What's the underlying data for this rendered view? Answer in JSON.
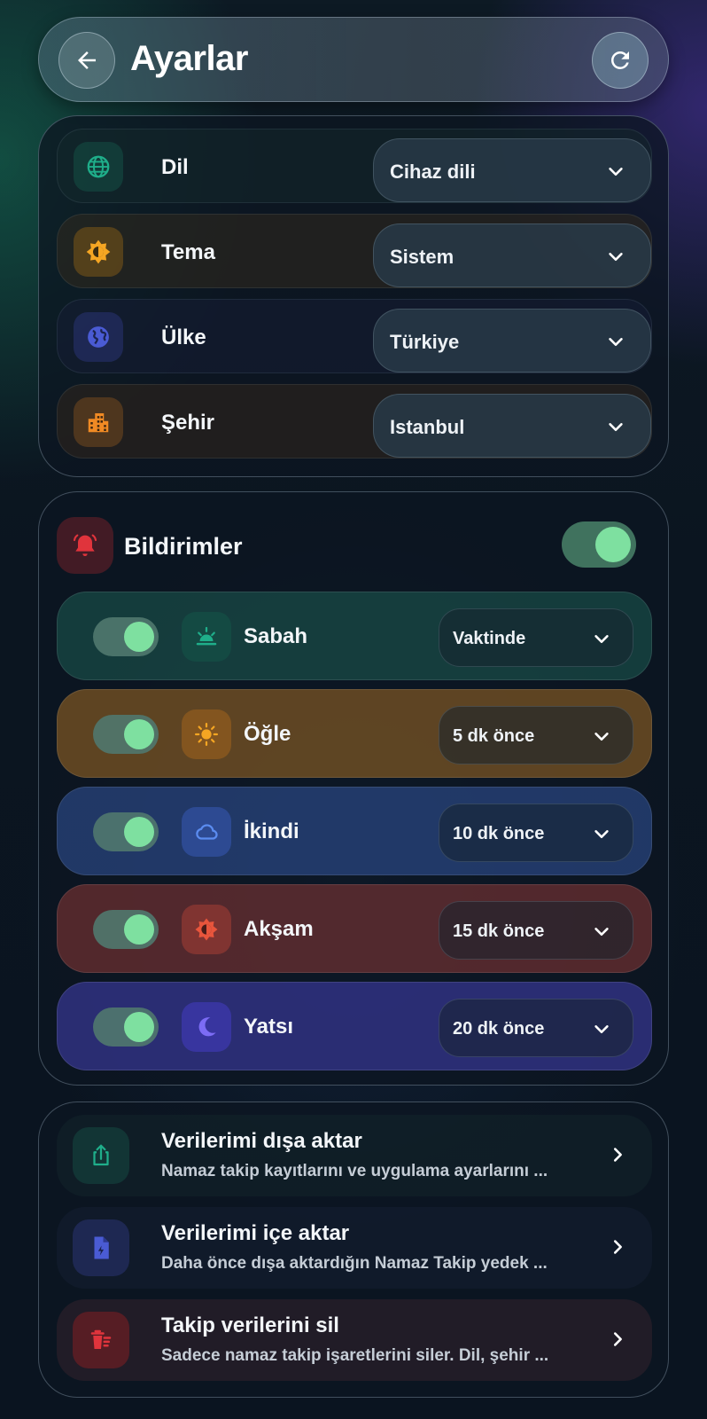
{
  "header": {
    "title": "Ayarlar"
  },
  "settings": [
    {
      "label": "Dil",
      "value": "Cihaz dili",
      "icon": "globe-icon",
      "accent": "#1fae8a"
    },
    {
      "label": "Tema",
      "value": "Sistem",
      "icon": "brightness-icon",
      "accent": "#f5a623"
    },
    {
      "label": "Ülke",
      "value": "Türkiye",
      "icon": "earth-icon",
      "accent": "#4a5bd4"
    },
    {
      "label": "Şehir",
      "value": "Istanbul",
      "icon": "city-icon",
      "accent": "#f08a24"
    }
  ],
  "notifications": {
    "title": "Bildirimler",
    "enabled": true,
    "prayers": [
      {
        "label": "Sabah",
        "value": "Vaktinde",
        "enabled": true,
        "icon": "sunrise-icon",
        "color": "#1e6a5c"
      },
      {
        "label": "Öğle",
        "value": "5 dk önce",
        "enabled": true,
        "icon": "sun-icon",
        "color": "#b07a28"
      },
      {
        "label": "İkindi",
        "value": "10 dk önce",
        "enabled": true,
        "icon": "cloud-icon",
        "color": "#2f4f94"
      },
      {
        "label": "Akşam",
        "value": "15 dk önce",
        "enabled": true,
        "icon": "sunset-icon",
        "color": "#8a3a3a"
      },
      {
        "label": "Yatsı",
        "value": "20 dk önce",
        "enabled": true,
        "icon": "moon-icon",
        "color": "#3a3a9a"
      }
    ]
  },
  "data_actions": [
    {
      "title": "Verilerimi dışa aktar",
      "subtitle": "Namaz takip kayıtlarını ve uygulama ayarlarını ...",
      "icon": "share-icon",
      "accent": "#1fae8a"
    },
    {
      "title": "Verilerimi içe aktar",
      "subtitle": "Daha önce dışa aktardığın Namaz Takip yedek ...",
      "icon": "file-import-icon",
      "accent": "#4a5bd4"
    },
    {
      "title": "Takip verilerini sil",
      "subtitle": "Sadece namaz takip işaretlerini siler. Dil, şehir ...",
      "icon": "delete-icon",
      "accent": "#e0343c"
    }
  ]
}
